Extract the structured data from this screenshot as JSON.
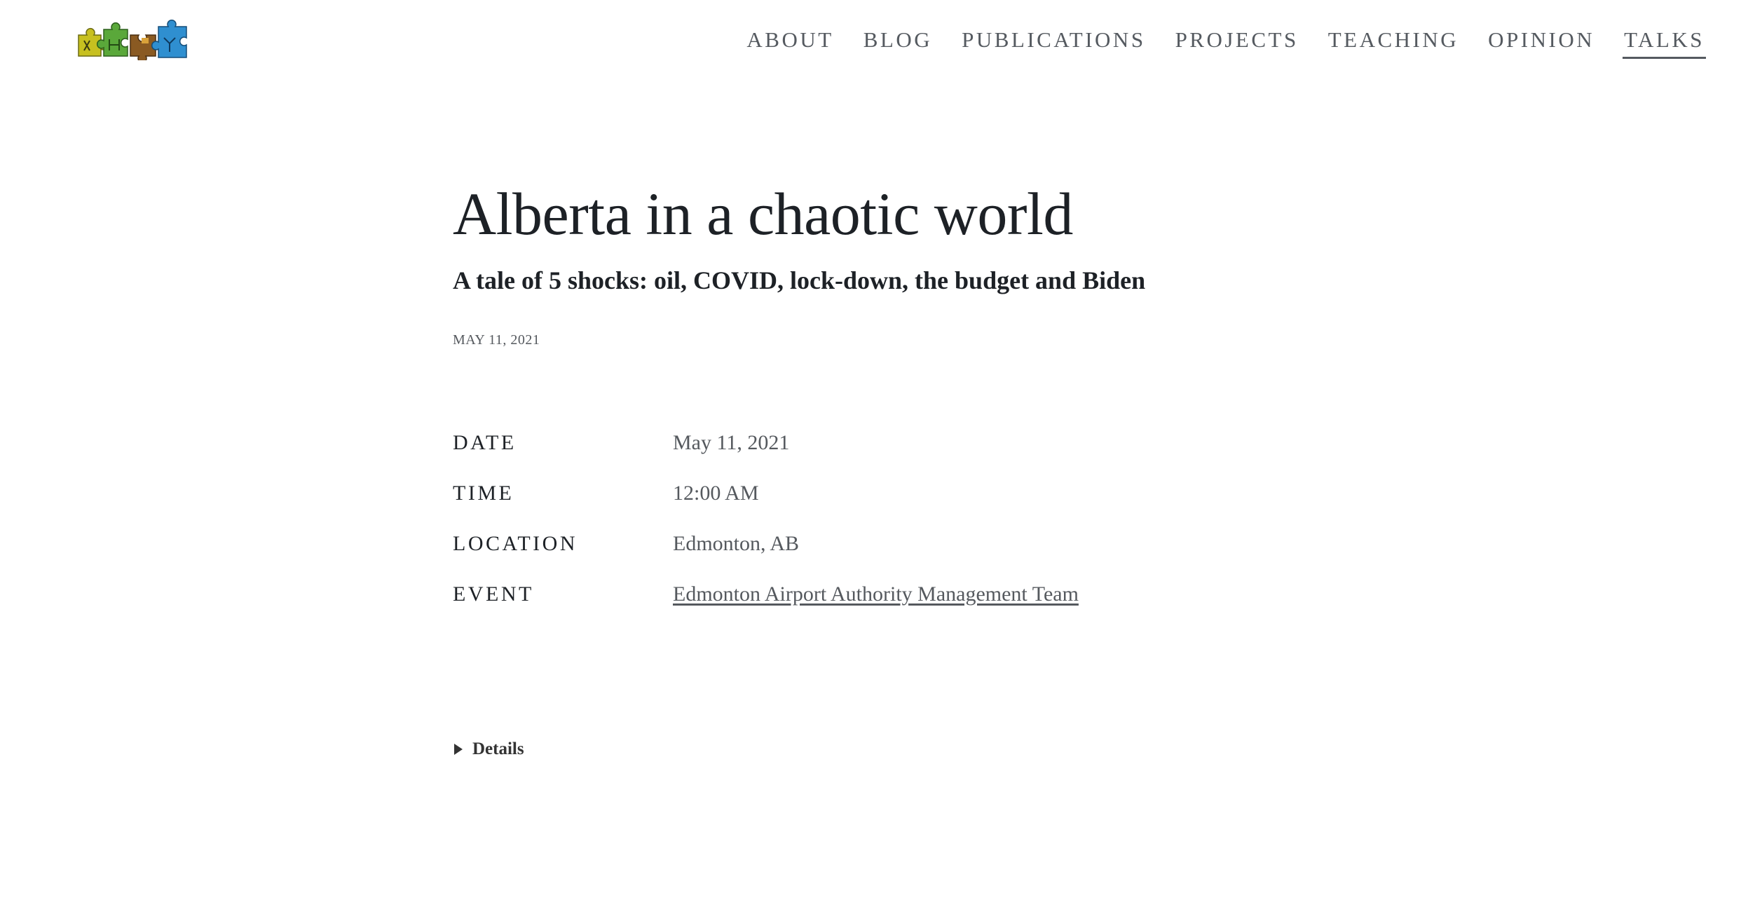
{
  "site": {
    "logo_icon": "puzzle-pieces-logo-icon"
  },
  "nav": {
    "items": [
      {
        "label": "ABOUT"
      },
      {
        "label": "BLOG"
      },
      {
        "label": "PUBLICATIONS"
      },
      {
        "label": "PROJECTS"
      },
      {
        "label": "TEACHING"
      },
      {
        "label": "OPINION"
      },
      {
        "label": "TALKS"
      }
    ],
    "active": "TALKS"
  },
  "talk": {
    "title": "Alberta in a chaotic world",
    "subtitle": "A tale of 5 shocks: oil, COVID, lock-down, the budget and Biden",
    "published": "MAY 11, 2021",
    "fields": [
      {
        "label": "DATE",
        "value": "May 11, 2021"
      },
      {
        "label": "TIME",
        "value": "12:00 AM"
      },
      {
        "label": "LOCATION",
        "value": "Edmonton, AB"
      },
      {
        "label": "EVENT",
        "value": "Edmonton Airport Authority Management Team"
      }
    ],
    "details_label": "Details"
  },
  "colors": {
    "text": "#1d2126",
    "muted": "#55595e",
    "nav": "#555a60",
    "logo_yellow": "#c7c020",
    "logo_green": "#5aa83a",
    "logo_brown": "#8a5a22",
    "logo_blue": "#2f8fd0"
  }
}
